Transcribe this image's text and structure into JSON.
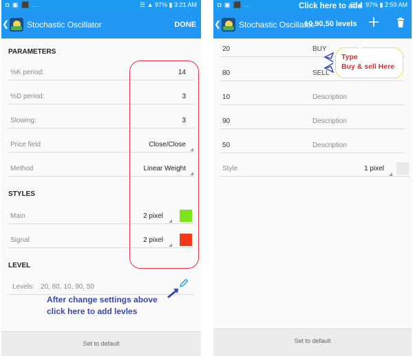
{
  "left": {
    "status_left": "◘ ▣ ⬛ ...",
    "status_right": "☰ ▲ 97% ▮ 3:21 AM",
    "back": "❮",
    "title": "Stochastic Oscillator",
    "done": "DONE",
    "sections": {
      "parameters": "PARAMETERS",
      "styles": "STYLES",
      "level": "LEVEL"
    },
    "params": [
      {
        "label": "%K period:",
        "value": "14"
      },
      {
        "label": "%D period:",
        "value": "3"
      },
      {
        "label": "Slowing:",
        "value": "3"
      },
      {
        "label": "Price field",
        "value": "Close/Close"
      },
      {
        "label": "Method",
        "value": "Linear Weight"
      }
    ],
    "styles": [
      {
        "label": "Main",
        "value": "2 pixel",
        "color": "#7fe31c"
      },
      {
        "label": "Signal",
        "value": "2 pixel",
        "color": "#f23a1b"
      }
    ],
    "levels": {
      "label": "Levels:",
      "value": "20, 80, 10, 90, 50"
    },
    "note": "After change settings above\nclick here to add levles",
    "default": "Set to default"
  },
  "right": {
    "status_left": "◘ ▣ ⬛ ...",
    "status_right": "☰ ▲ 97% ▮ 2:59 AM",
    "back": "❮",
    "title": "Stochastic Oscillator",
    "click_note": "Click here to add",
    "levels_note": "10,90,50 levels",
    "levels": [
      {
        "value": "20",
        "desc": "BUY",
        "desc_dark": true
      },
      {
        "value": "80",
        "desc": "SELL",
        "desc_dark": true
      },
      {
        "value": "10",
        "desc": "Description",
        "desc_dark": false
      },
      {
        "value": "90",
        "desc": "Description",
        "desc_dark": false
      },
      {
        "value": "50",
        "desc": "Description",
        "desc_dark": false
      }
    ],
    "style": {
      "label": "Style",
      "value": "1 pixel"
    },
    "type_note": "Type\nBuy & sell Here",
    "default": "Set to default",
    "colors": {
      "red_box": "#e8334a",
      "yellow_box": "#ffd54f",
      "blue_note": "#3949ab",
      "type_note": "#d32f2f"
    }
  }
}
